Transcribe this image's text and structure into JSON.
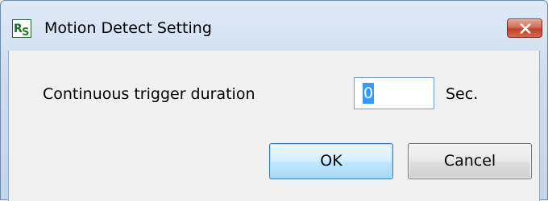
{
  "window": {
    "title": "Motion Detect Setting",
    "icon": "rs-app-icon",
    "icon_text": "RS",
    "close_icon": "close-icon"
  },
  "form": {
    "duration_label": "Continuous trigger duration",
    "duration_value": "0",
    "unit_label": "Sec."
  },
  "buttons": {
    "ok_label": "OK",
    "cancel_label": "Cancel"
  },
  "colors": {
    "close_button": "#c9533a",
    "selection": "#3399ff",
    "ok_border": "#3c7fb1"
  }
}
